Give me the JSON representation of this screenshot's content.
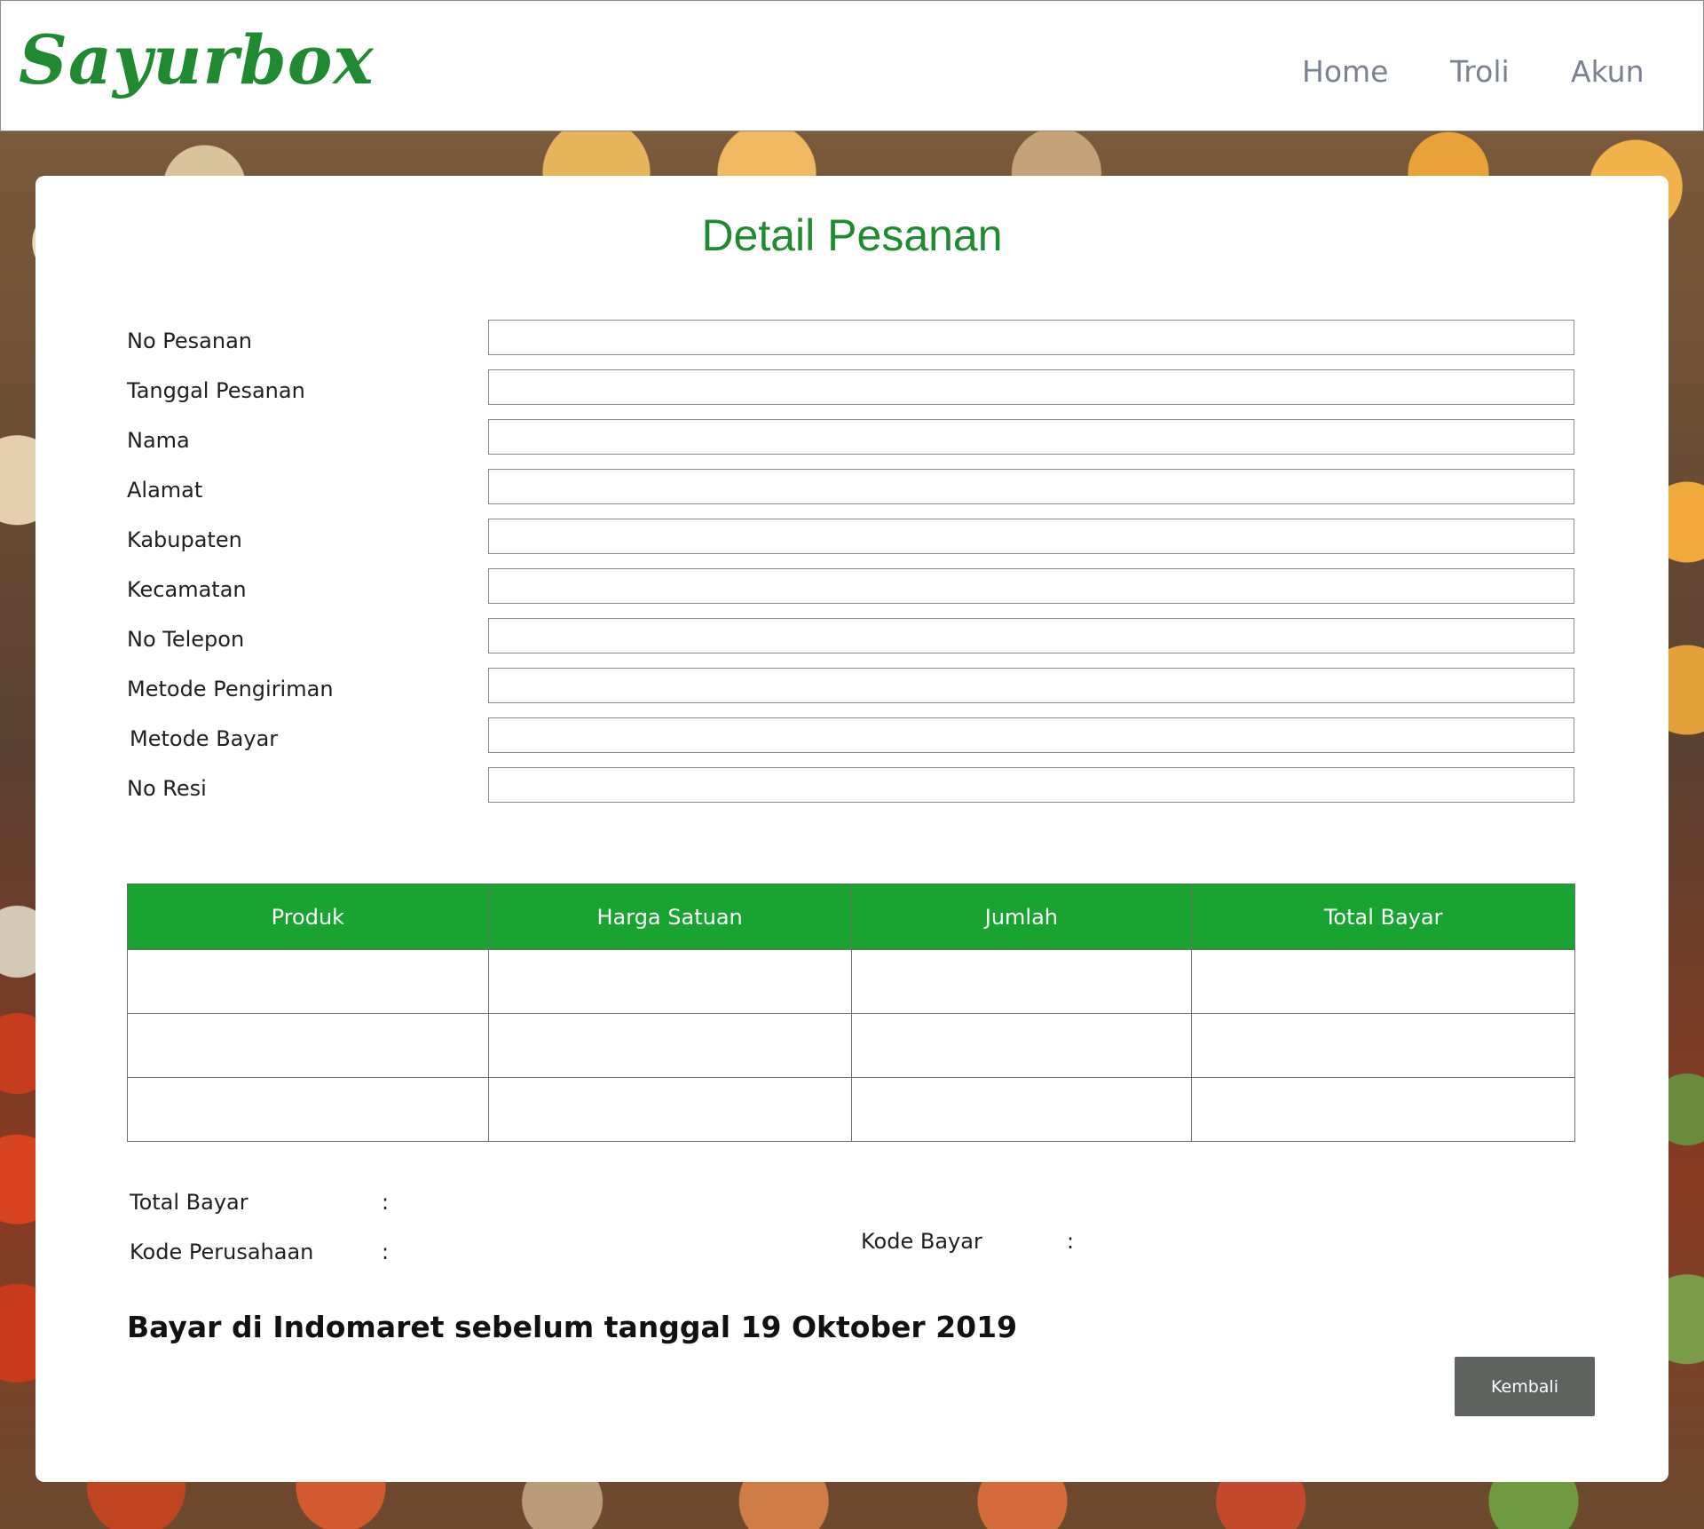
{
  "header": {
    "logo": "Sayurbox",
    "nav": {
      "home": "Home",
      "troli": "Troli",
      "akun": "Akun"
    }
  },
  "page": {
    "title": "Detail Pesanan"
  },
  "form": {
    "fields": [
      {
        "label": "No Pesanan",
        "value": ""
      },
      {
        "label": "Tanggal Pesanan",
        "value": ""
      },
      {
        "label": "Nama",
        "value": ""
      },
      {
        "label": "Alamat",
        "value": ""
      },
      {
        "label": "Kabupaten",
        "value": ""
      },
      {
        "label": "Kecamatan",
        "value": ""
      },
      {
        "label": "No Telepon",
        "value": ""
      },
      {
        "label": "Metode Pengiriman",
        "value": ""
      },
      {
        "label": "Metode Bayar",
        "value": ""
      },
      {
        "label": "No Resi",
        "value": ""
      }
    ]
  },
  "table": {
    "columns": [
      "Produk",
      "Harga Satuan",
      "Jumlah",
      "Total Bayar"
    ],
    "rows": [
      [
        "",
        "",
        "",
        ""
      ],
      [
        "",
        "",
        "",
        ""
      ],
      [
        "",
        "",
        "",
        ""
      ]
    ]
  },
  "summary": {
    "total_bayar_label": "Total Bayar",
    "kode_perusahaan_label": "Kode Perusahaan",
    "kode_bayar_label": "Kode Bayar",
    "separator": ":"
  },
  "notice": "Bayar di Indomaret sebelum tanggal 19 Oktober 2019",
  "actions": {
    "back_label": "Kembali"
  },
  "colors": {
    "brand_green": "#1f8a2f",
    "header_green": "#19a330",
    "button_gray": "#5f6360"
  }
}
